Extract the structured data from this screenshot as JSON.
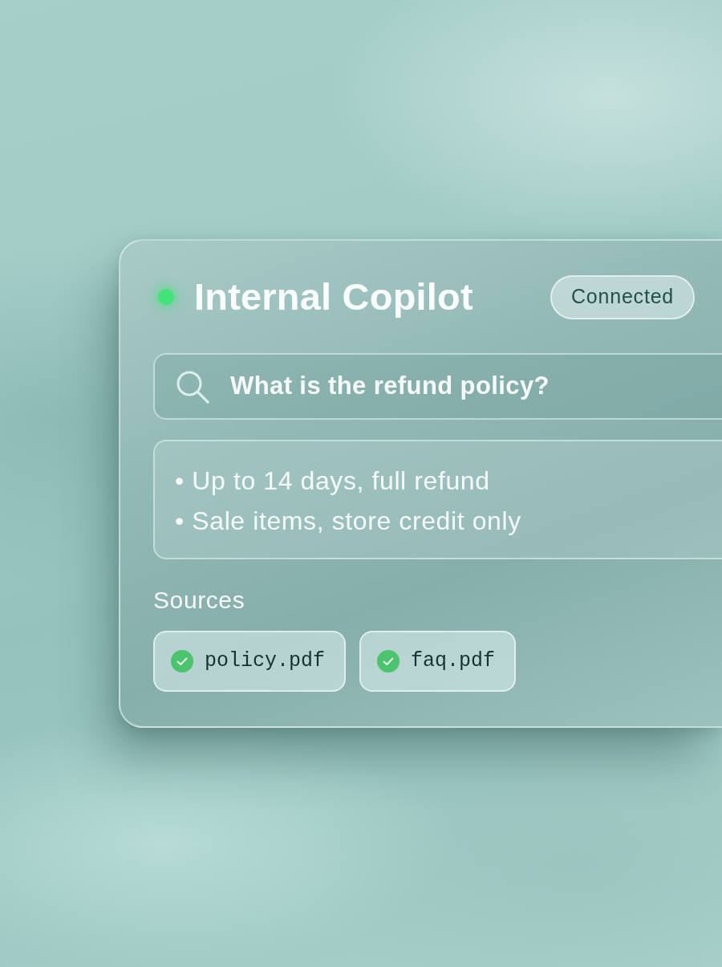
{
  "header": {
    "online": true,
    "title": "Internal Copilot",
    "status_badge": "Connected"
  },
  "search": {
    "value": "What is the refund policy?"
  },
  "answer": {
    "items": [
      "• Up to 14 days, full refund",
      "• Sale items, store credit only"
    ]
  },
  "sources": {
    "label": "Sources",
    "items": [
      {
        "name": "policy.pdf",
        "verified": true
      },
      {
        "name": "faq.pdf",
        "verified": true
      }
    ]
  }
}
